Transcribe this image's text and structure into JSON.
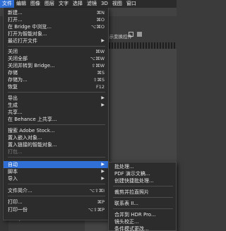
{
  "menubar": {
    "items": [
      "文件",
      "编辑",
      "图像",
      "图层",
      "文字",
      "选择",
      "滤镜",
      "3D",
      "视图",
      "窗口"
    ]
  },
  "options_bar": {
    "label": "显示变换控件"
  },
  "file_menu": {
    "new": {
      "label": "新建...",
      "shortcut": "⌘N"
    },
    "open": {
      "label": "打开...",
      "shortcut": "⌘O"
    },
    "browse_bridge": {
      "label": "在 Bridge 中浏览...",
      "shortcut": "⌥⌘O"
    },
    "open_smart": {
      "label": "打开为智能对象..."
    },
    "recent": {
      "label": "最近打开文件"
    },
    "close": {
      "label": "关闭",
      "shortcut": "⌘W"
    },
    "close_all": {
      "label": "关闭全部",
      "shortcut": "⌥⌘W"
    },
    "close_to_bridge": {
      "label": "关闭并转到 Bridge...",
      "shortcut": "⇧⌘W"
    },
    "save": {
      "label": "存储",
      "shortcut": "⌘S"
    },
    "save_as": {
      "label": "存储为...",
      "shortcut": "⇧⌘S"
    },
    "revert": {
      "label": "恢复",
      "shortcut": "F12"
    },
    "export": {
      "label": "导出"
    },
    "generate": {
      "label": "生成"
    },
    "share": {
      "label": "共享..."
    },
    "behance": {
      "label": "在 Behance 上共享..."
    },
    "search_stock": {
      "label": "搜索 Adobe Stock..."
    },
    "place_embedded": {
      "label": "置入嵌入对象..."
    },
    "place_linked": {
      "label": "置入链接的智能对象..."
    },
    "package": {
      "label": "打包..."
    },
    "automate": {
      "label": "自动"
    },
    "scripts": {
      "label": "脚本"
    },
    "import": {
      "label": "导入"
    },
    "file_info": {
      "label": "文件简介...",
      "shortcut": "⌥⇧⌘I"
    },
    "print": {
      "label": "打印...",
      "shortcut": "⌘P"
    },
    "print_one": {
      "label": "打印一份",
      "shortcut": "⌥⇧⌘P"
    }
  },
  "automate_submenu": {
    "batch": "批处理...",
    "pdf_slideshow": "PDF 演示文稿...",
    "create_droplet": "创建快捷批处理...",
    "crop_straighten": "裁剪并拉直照片",
    "contact_sheet": "联系表 II...",
    "merge_hdr": "合并到 HDR Pro...",
    "lens_correction": "镜头校正...",
    "conditional_mode": "条件模式更改..."
  },
  "colors": {
    "menu_bg": "#2c2c2c",
    "highlight": "#2f6fd6",
    "text": "#e8e8e8",
    "disabled_text": "#7d7d7d"
  }
}
